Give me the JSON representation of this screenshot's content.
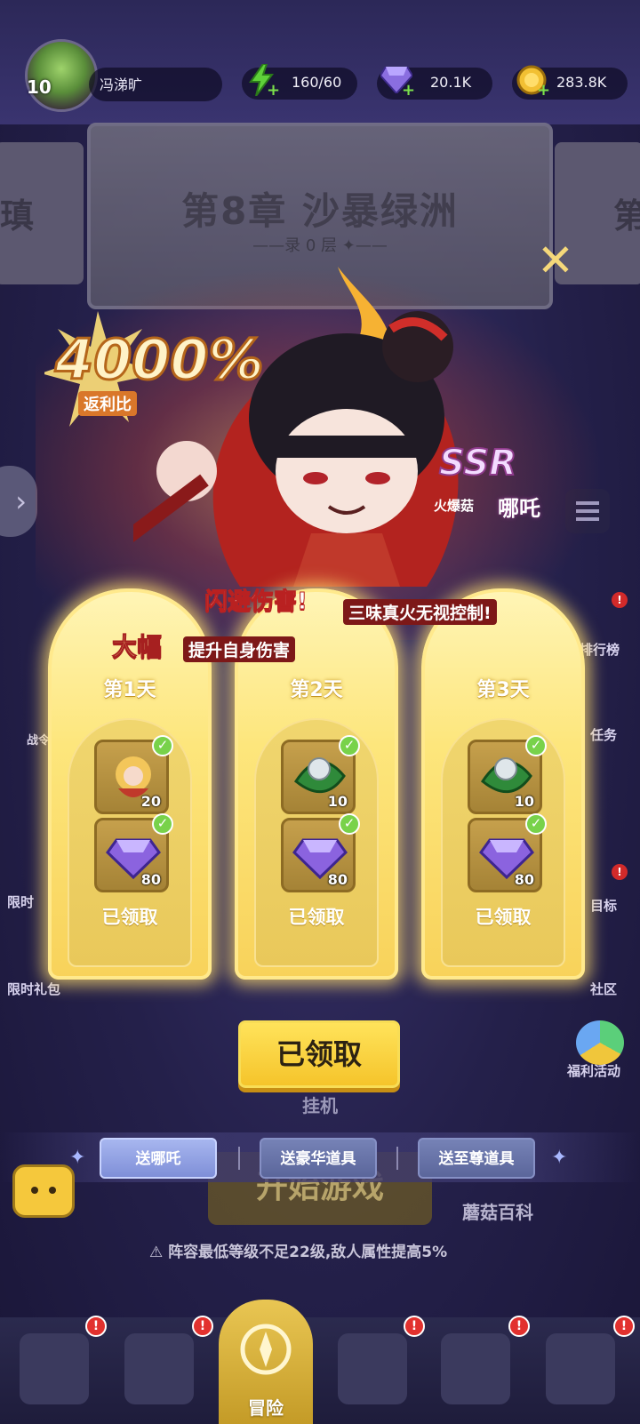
{
  "hud": {
    "level": "10",
    "player_name": "冯涕旷",
    "energy": "160/60",
    "gems": "20.1K",
    "coins": "283.8K",
    "energy_icon": "lightning-icon",
    "gem_icon": "gem-icon",
    "coin_icon": "coin-icon"
  },
  "chapter": {
    "title": "第8章 沙暴绿洲",
    "subtitle": "——录 0 层 ✦——",
    "side_left": "瑱",
    "side_right": "第"
  },
  "promo": {
    "ratio": "4000%",
    "ratio_label": "返利比",
    "rarity": "SSR",
    "hero_class": "火爆菇",
    "hero_name": "哪吒",
    "feature1_highlight": "闪避伤害!",
    "feature1_text": "三味真火无视控制!",
    "feature2_highlight": "大幅",
    "feature2_text": "提升自身伤害"
  },
  "rewards": [
    {
      "day": "第1天",
      "items": [
        {
          "icon": "hero-shard-icon",
          "count": "20"
        },
        {
          "icon": "purple-gem-icon",
          "count": "80"
        }
      ],
      "status": "已领取"
    },
    {
      "day": "第2天",
      "items": [
        {
          "icon": "green-leaf-orb-icon",
          "count": "10"
        },
        {
          "icon": "purple-gem-icon",
          "count": "80"
        }
      ],
      "status": "已领取"
    },
    {
      "day": "第3天",
      "items": [
        {
          "icon": "green-leaf-orb-icon",
          "count": "10"
        },
        {
          "icon": "purple-gem-icon",
          "count": "80"
        }
      ],
      "status": "已领取"
    }
  ],
  "claim_button": "已领取",
  "tabs": [
    "送哪吒",
    "送豪华道具",
    "送至尊道具"
  ],
  "background": {
    "idle_label": "挂机",
    "start_label": "开始游戏",
    "encyclopedia_label": "蘑菇百科",
    "warning": "阵容最低等级不足22级,敌人属性提高5%",
    "side_left_labels": [
      "战令",
      "限时",
      "限时礼包"
    ],
    "side_right_labels": [
      "排行榜",
      "任务",
      "目标",
      "社区",
      "福利活动"
    ]
  },
  "bottom_nav": {
    "adventure_label": "冒险"
  },
  "colors": {
    "card_gold": "#f8d25a",
    "claim_yellow": "#f5c42b",
    "tab_active": "#7f8fd8",
    "notification_red": "#e2312e"
  }
}
